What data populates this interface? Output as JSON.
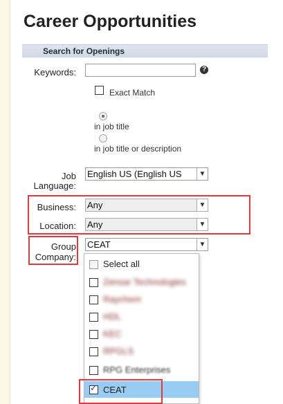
{
  "page": {
    "title": "Career Opportunities"
  },
  "section": {
    "label": "Search for Openings"
  },
  "form": {
    "keywords_label": "Keywords:",
    "keywords_value": "",
    "help_icon": "question-circle-icon",
    "exact_match_label": "Exact Match",
    "radio_job_title": "in job title",
    "radio_title_desc": "in job title or description",
    "job_language_label_1": "Job",
    "job_language_label_2": "Language:",
    "job_language_value": "English US (English US",
    "business_label": "Business:",
    "business_value": "Any",
    "location_label": "Location:",
    "location_value": "Any",
    "group_label_1": "Group",
    "group_label_2": "Company:",
    "group_value": "CEAT"
  },
  "dropdown": {
    "select_all": "Select all",
    "items": [
      {
        "label": "Zensar Technologies",
        "blurred": true
      },
      {
        "label": "Raychem",
        "blurred": true
      },
      {
        "label": "HDL",
        "blurred": true
      },
      {
        "label": "KEC",
        "blurred": true
      },
      {
        "label": "RPGLS",
        "blurred": true
      },
      {
        "label": "RPG Enterprises",
        "blurred": true
      },
      {
        "label": "CEAT",
        "blurred": false,
        "checked": true
      }
    ]
  },
  "colors": {
    "highlight": "#e0383d",
    "selected_bg": "#99ccf2",
    "section_bg": "#d6dde8"
  }
}
